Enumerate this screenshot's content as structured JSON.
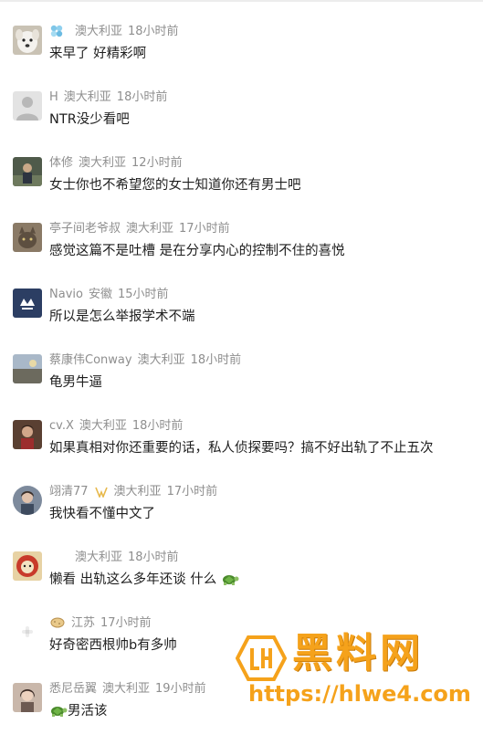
{
  "comments": [
    {
      "avatar_icon": "white-dog-avatar",
      "badge_icon": "fan-badge-icon",
      "name": "",
      "location": "澳大利亚",
      "time": "18小时前",
      "text": "来早了 好精彩啊"
    },
    {
      "avatar_icon": "default-user-avatar",
      "name": "H",
      "location": "澳大利亚",
      "time": "18小时前",
      "text": "NTR没少看吧"
    },
    {
      "avatar_icon": "person-photo-avatar",
      "name": "体修",
      "location": "澳大利亚",
      "time": "12小时前",
      "text": "女士你也不希望您的女士知道你还有男士吧"
    },
    {
      "avatar_icon": "cat-photo-avatar",
      "name": "亭子间老爷叔",
      "location": "澳大利亚",
      "time": "17小时前",
      "text": "感觉这篇不是吐槽 是在分享内心的控制不住的喜悦"
    },
    {
      "avatar_icon": "navy-logo-avatar",
      "name": "Navio",
      "location": "安徽",
      "time": "15小时前",
      "text": "所以是怎么举报学术不端"
    },
    {
      "avatar_icon": "landscape-avatar",
      "name": "蔡康伟Conway",
      "location": "澳大利亚",
      "time": "18小时前",
      "text": "龟男牛逼"
    },
    {
      "avatar_icon": "portrait-photo-avatar",
      "name": "cv.X",
      "location": "澳大利亚",
      "time": "18小时前",
      "text": "如果真相对你还重要的话，私人侦探要吗？搞不好出轨了不止五次"
    },
    {
      "avatar_icon": "round-portrait-avatar",
      "badge_icon": "vip-badge-icon",
      "name": "翊清77",
      "location": "澳大利亚",
      "time": "17小时前",
      "text": "我快看不懂中文了"
    },
    {
      "avatar_icon": "cartoon-avatar",
      "name": "",
      "location": "澳大利亚",
      "time": "18小时前",
      "text_before": "懒看 出轨这么多年还谈 什么",
      "emoji_icon": "turtle-emoji-icon"
    },
    {
      "avatar_icon": "small-flower-avatar",
      "badge_icon": "potato-badge-icon",
      "name": "江苏",
      "location": "",
      "time": "17小时前",
      "text": "好奇密西根帅b有多帅"
    },
    {
      "avatar_icon": "woman-photo-avatar",
      "name": "悉尼岳翼",
      "location": "澳大利亚",
      "time": "19小时前",
      "emoji_icon": "turtle-emoji-icon",
      "text_after": "男活该"
    }
  ],
  "watermark": {
    "title": "黑料网",
    "url": "https://hlwe4.com",
    "color": "#f5a21b"
  }
}
